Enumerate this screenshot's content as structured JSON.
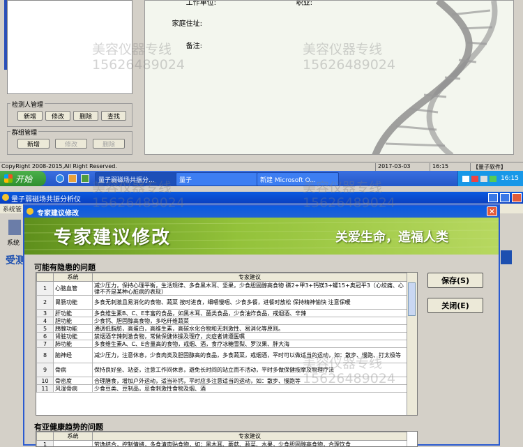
{
  "top_app": {
    "groups": {
      "tester_mgmt": {
        "title": "检测人管理",
        "buttons": [
          "新增",
          "修改",
          "删除",
          "查找"
        ]
      },
      "group_mgmt": {
        "title": "群组管理",
        "buttons": [
          "新增",
          "修改",
          "删除"
        ]
      }
    },
    "profile": {
      "fields": [
        "工作单位:",
        "职业:",
        "家庭住址:",
        "备注:"
      ]
    },
    "statusbar": {
      "copyright": "CopyRight 2008-2015,All Right Reserved.",
      "date": "2017-03-03",
      "time": "16:15",
      "brand": "【量子软件】"
    }
  },
  "taskbar": {
    "start_label": "开始",
    "tasks": [
      "量子弱磁场共振分...",
      "量子",
      "新建 Microsoft O..."
    ],
    "clock": "16:15"
  },
  "app2": {
    "title": "量子弱磁场共振分析仪",
    "menu": [
      "系统管"
    ],
    "side_labels": [
      "系统",
      "受测"
    ]
  },
  "dialog": {
    "title": "专家建议修改",
    "close_label": "×",
    "banner": {
      "title": "专家建议修改",
      "slogan": "关爱生命，造福人类"
    },
    "save_label": "保存(S)",
    "close_btn_label": "关闭(E)",
    "section1": {
      "title": "可能有隐患的问题",
      "headers": [
        "",
        "系统",
        "专家建议"
      ],
      "rows": [
        [
          "1",
          "心脑血管",
          "减少压力，保持心理平衡，生活规律、多食黑木耳、坚果，少食胆固醇高食物 磷2+甲3+钙镁3+螺15+奥冠平3（心绞痛、心律不齐是某种心脏病的表现）"
        ],
        [
          "2",
          "胃肠功能",
          "多食无刺激且易消化的食物、蔬菜 按时进食，细嚼慢咽、少食多餐，进餐时放松 保持精神愉快 注意保暖"
        ],
        [
          "3",
          "肝功能",
          "多食维生素B、C、E丰富的食品，如黑木耳、菌类食品，少食油炸食品，戒烟酒、辛辣"
        ],
        [
          "4",
          "胆功能",
          "少食钙、胆固醇高食物，多吃纤维蔬菜"
        ],
        [
          "5",
          "胰腺功能",
          "通调低脂肪，高蛋白，高维生素，高碳水化合物和无刺激性、易消化等原则。"
        ],
        [
          "6",
          "肾脏功能",
          "禁烟酒辛辣刺激食物，常做保健体操及理疗，炎症者请遵医嘱"
        ],
        [
          "7",
          "肺功能",
          "多食维生素A、C、E含量高的食物，戒烟、酒，食疗冰糖雪梨、罗汉果、胖大海"
        ],
        [
          "8",
          "脑神经",
          "减少压力，注意休息，少食肉类及胆固醇高的食品，多食蔬菜，戒烟酒，平时可以做适当的运动，如：散步、慢跑、打太极等"
        ],
        [
          "9",
          "骨病",
          "保持良好坐、站姿，注意工作间休息，避免长时间的站立而不活动，平时多做保健按摩及物理疗法"
        ],
        [
          "10",
          "骨密度",
          "合理膳食，增加户外运动，适当补钙，平时应多注意适当的运动，如：散步、慢跑等"
        ],
        [
          "11",
          "风湿骨病",
          "少食豆类、豆制品，忌食刺激性食物及烟、酒"
        ]
      ]
    },
    "section2": {
      "title": "有亚健康趋势的问题",
      "headers": [
        "",
        "系统",
        "专家建议"
      ],
      "rows": [
        [
          "1",
          "",
          "劳逸结合，控制情绪，多食清肉贴食物，如：黑木耳、蘑菇、蔬菜、水果，少食胆固醇高食物，合理饮食"
        ]
      ]
    }
  },
  "watermark": {
    "line1": "美容仪器专线",
    "line2": "15626489024"
  },
  "colors": {
    "xp_blue": "#0a5ae0",
    "banner_green": "#7fb02c",
    "taskbar": "#2457c8"
  }
}
